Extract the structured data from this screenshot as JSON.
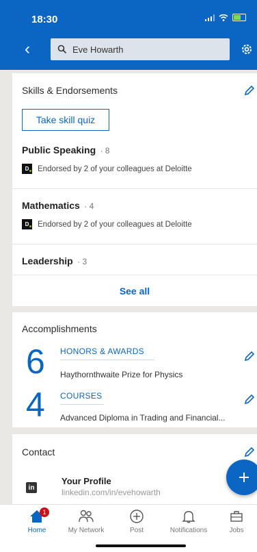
{
  "status": {
    "time": "18:30"
  },
  "search": {
    "query": "Eve Howarth"
  },
  "skills": {
    "title": "Skills & Endorsements",
    "quiz_label": "Take skill quiz",
    "items": [
      {
        "name": "Public Speaking",
        "count": "· 8",
        "endorsement": "Endorsed by 2 of your colleagues at Deloitte"
      },
      {
        "name": "Mathematics",
        "count": "· 4",
        "endorsement": "Endorsed by 2 of your colleagues at Deloitte"
      },
      {
        "name": "Leadership",
        "count": "· 3"
      }
    ],
    "see_all": "See all"
  },
  "accomplishments": {
    "title": "Accomplishments",
    "items": [
      {
        "number": "6",
        "category": "HONORS & AWARDS",
        "item": "Haythornthwaite Prize for Physics"
      },
      {
        "number": "4",
        "category": "COURSES",
        "item": "Advanced Diploma in Trading and Financial..."
      }
    ]
  },
  "contact": {
    "title": "Contact",
    "profile_label": "Your Profile",
    "profile_url": "linkedin.com/in/evehowarth"
  },
  "bottom_nav": {
    "home": "Home",
    "network": "My Network",
    "post": "Post",
    "notifications": "Notifications",
    "jobs": "Jobs",
    "home_badge": "1"
  },
  "colors": {
    "brand": "#0a66c2",
    "background": "#e9e8e4",
    "badge": "#cc1016"
  }
}
